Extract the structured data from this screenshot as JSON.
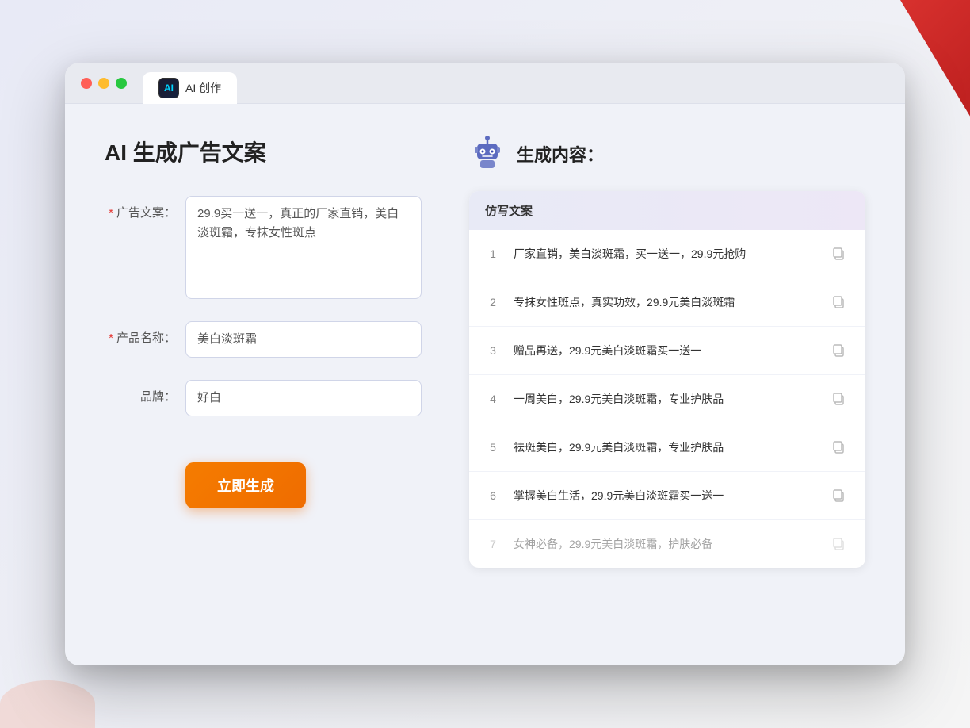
{
  "window": {
    "tab_label": "AI 创作",
    "ai_logo_text": "AI"
  },
  "left_panel": {
    "page_title": "AI 生成广告文案",
    "form": {
      "ad_copy_label": "广告文案：",
      "ad_copy_required": true,
      "ad_copy_value": "29.9买一送一，真正的厂家直销，美白淡斑霜，专抹女性斑点",
      "product_name_label": "产品名称：",
      "product_name_required": true,
      "product_name_value": "美白淡斑霜",
      "brand_label": "品牌：",
      "brand_required": false,
      "brand_value": "好白"
    },
    "generate_button": "立即生成"
  },
  "right_panel": {
    "title": "生成内容：",
    "results_header": "仿写文案",
    "results": [
      {
        "num": "1",
        "text": "厂家直销，美白淡斑霜，买一送一，29.9元抢购",
        "faded": false
      },
      {
        "num": "2",
        "text": "专抹女性斑点，真实功效，29.9元美白淡斑霜",
        "faded": false
      },
      {
        "num": "3",
        "text": "赠品再送，29.9元美白淡斑霜买一送一",
        "faded": false
      },
      {
        "num": "4",
        "text": "一周美白，29.9元美白淡斑霜，专业护肤品",
        "faded": false
      },
      {
        "num": "5",
        "text": "祛斑美白，29.9元美白淡斑霜，专业护肤品",
        "faded": false
      },
      {
        "num": "6",
        "text": "掌握美白生活，29.9元美白淡斑霜买一送一",
        "faded": false
      },
      {
        "num": "7",
        "text": "女神必备，29.9元美白淡斑霜，护肤必备",
        "faded": true
      }
    ]
  },
  "icons": {
    "copy": "⊡",
    "robot_color_head": "#5c6bc0",
    "robot_color_eye": "#ffffff",
    "robot_color_antenna": "#5c6bc0"
  }
}
